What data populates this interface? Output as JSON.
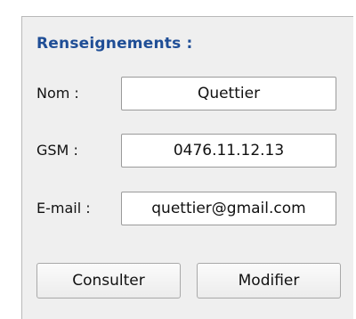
{
  "panel": {
    "title": "Renseignements :",
    "fields": {
      "nom": {
        "label": "Nom :",
        "value": "Quettier"
      },
      "gsm": {
        "label": "GSM :",
        "value": "0476.11.12.13"
      },
      "email": {
        "label": "E-mail :",
        "value": "quettier@gmail.com"
      }
    },
    "buttons": {
      "consulter": "Consulter",
      "modifier": "Modifier"
    }
  },
  "colors": {
    "title": "#1f4e96",
    "panel_background": "#efefef"
  }
}
